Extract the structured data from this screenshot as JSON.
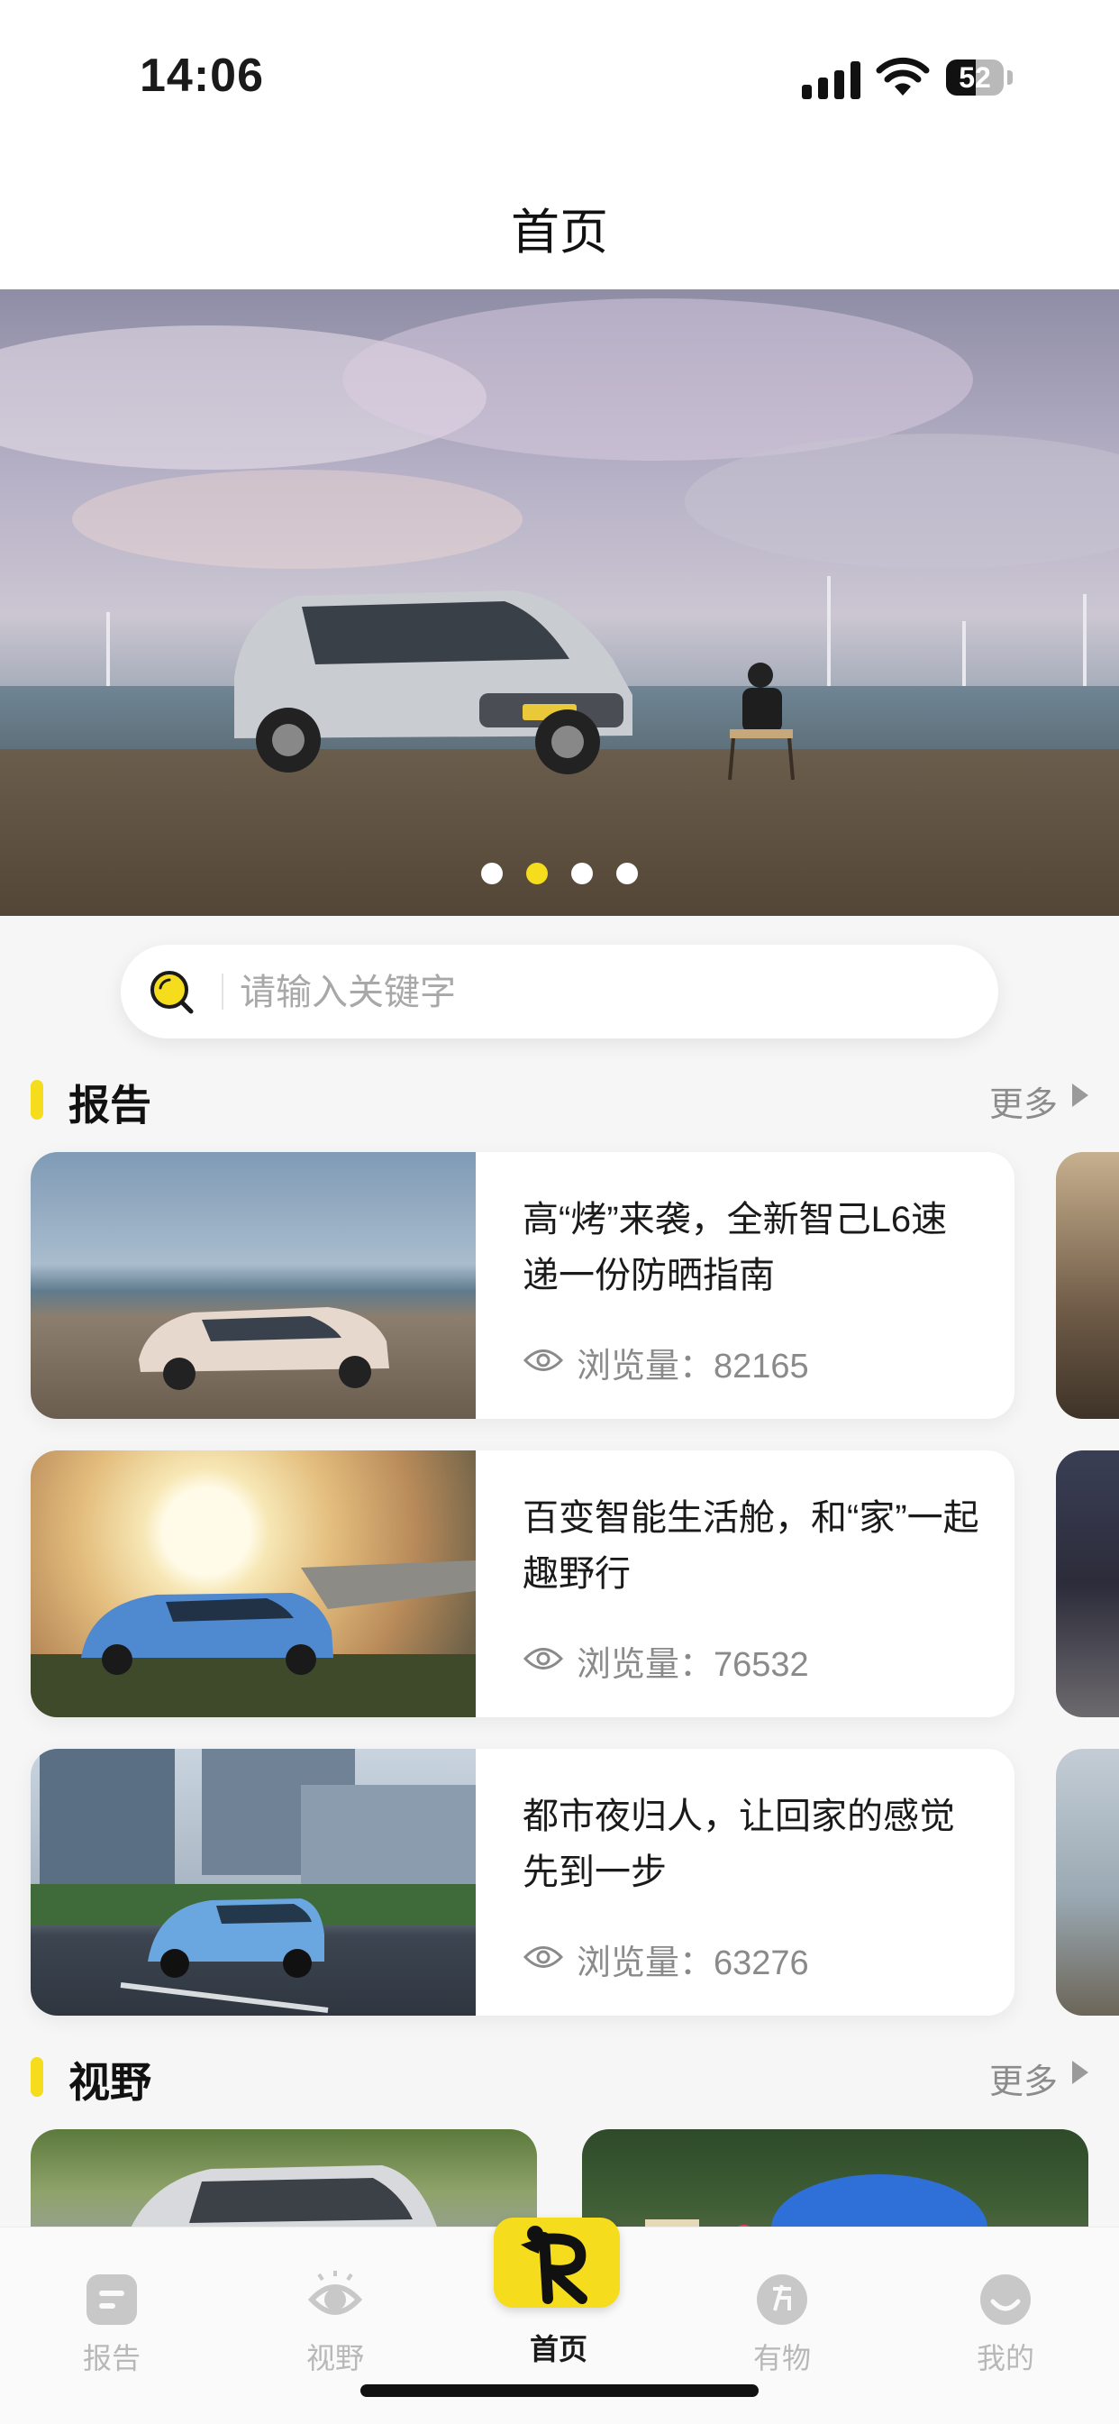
{
  "status_bar": {
    "time": "14:06",
    "battery": "52",
    "battery_level": 0.52
  },
  "nav": {
    "title": "首页"
  },
  "banner": {
    "slide_count": 4,
    "active_index": 1
  },
  "search": {
    "placeholder": "请输入关键字"
  },
  "reports": {
    "title": "报告",
    "more": "更多",
    "items": [
      {
        "title": "高“烤”来袭，全新智己L6速递一份防晒指南",
        "views_label": "浏览量：",
        "views": "82165"
      },
      {
        "title": "百变智能生活舱，和“家”一起趣野行",
        "views_label": "浏览量：",
        "views": "76532"
      },
      {
        "title": "都市夜归人，让回家的感觉先到一步",
        "views_label": "浏览量：",
        "views": "63276"
      }
    ]
  },
  "vision": {
    "title": "视野",
    "more": "更多"
  },
  "tabbar": {
    "items": [
      {
        "label": "报告",
        "icon": "report-icon",
        "active": false
      },
      {
        "label": "视野",
        "icon": "eye-icon",
        "active": false
      },
      {
        "label": "首页",
        "icon": "home-r-logo-icon",
        "active": true
      },
      {
        "label": "有物",
        "icon": "youwu-icon",
        "active": false
      },
      {
        "label": "我的",
        "icon": "profile-icon",
        "active": false
      }
    ]
  },
  "colors": {
    "accent": "#f5dc1d",
    "text": "#1a1a1a",
    "muted": "#8a8a8a"
  }
}
